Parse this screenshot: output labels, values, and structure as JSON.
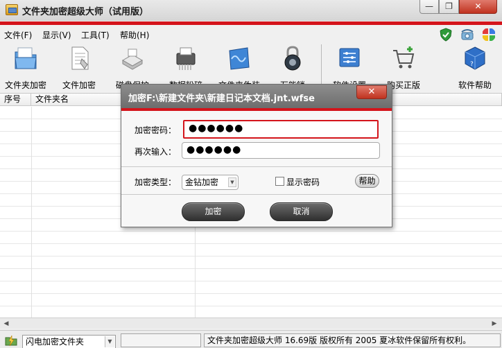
{
  "window": {
    "title": "文件夹加密超级大师（试用版）",
    "minimize_glyph": "—",
    "maximize_glyph": "❐",
    "close_glyph": "✕"
  },
  "menu": {
    "items": [
      {
        "label": "文件(F)"
      },
      {
        "label": "显示(V)"
      },
      {
        "label": "工具(T)"
      },
      {
        "label": "帮助(H)"
      }
    ],
    "right_icons": [
      "shield-check-icon",
      "telephone-icon",
      "puzzle-icon"
    ]
  },
  "toolbar": {
    "items": [
      {
        "label": "文件夹加密",
        "icon": "folder-icon"
      },
      {
        "label": "文件加密",
        "icon": "document-icon"
      },
      {
        "label": "磁盘保护",
        "icon": "disk-icon"
      },
      {
        "label": "数据粉碎",
        "icon": "shredder-icon"
      },
      {
        "label": "文件夹伪装",
        "icon": "folder-disguise-icon"
      },
      {
        "label": "万能锁",
        "icon": "padlock-icon"
      },
      {
        "label": "软件设置",
        "icon": "settings-panel-icon"
      },
      {
        "label": "购买正版",
        "icon": "shopping-cart-icon"
      },
      {
        "label": "软件帮助",
        "icon": "help-cube-icon"
      }
    ]
  },
  "list": {
    "columns": [
      "序号",
      "文件夹名"
    ]
  },
  "statusbar": {
    "mode_select": "闪电加密文件夹",
    "empty_field": "",
    "info": "文件夹加密超级大师 16.69版 版权所有 2005 夏冰软件保留所有权利。"
  },
  "dialog": {
    "title": "加密F:\\新建文件夹\\新建日记本文档.jnt.wfse",
    "close_glyph": "✕",
    "password_label": "加密密码：",
    "password_value": "●●●●●●",
    "confirm_label": "再次输入：",
    "confirm_value": "●●●●●●",
    "type_label": "加密类型：",
    "type_value": "金钻加密",
    "show_password_label": "显示密码",
    "show_password_checked": false,
    "help_button": "帮助",
    "encrypt_button": "加密",
    "cancel_button": "取消"
  },
  "colors": {
    "accent_red": "#d4141b",
    "dialog_title_gray": "#7a7a7a",
    "dark_button": "#3a3a3a"
  }
}
